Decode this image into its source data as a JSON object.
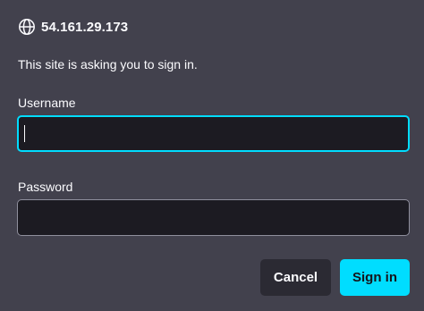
{
  "dialog": {
    "host": "54.161.29.173",
    "message": "This site is asking you to sign in.",
    "username_label": "Username",
    "username_value": "",
    "password_label": "Password",
    "password_value": "",
    "cancel_label": "Cancel",
    "signin_label": "Sign in"
  },
  "icons": {
    "host_icon": "globe-icon"
  },
  "colors": {
    "background": "#42414d",
    "field_background": "#1c1b22",
    "accent": "#00ddff",
    "text": "#fbfbfe",
    "cancel_button": "#2b2a33"
  }
}
